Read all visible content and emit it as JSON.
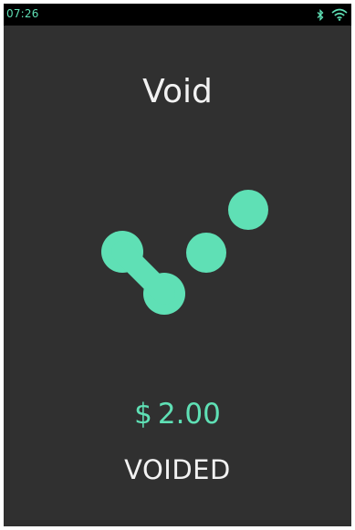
{
  "status_bar": {
    "time": "07:26",
    "icons": [
      "bluetooth-icon",
      "wifi-icon"
    ]
  },
  "screen": {
    "title": "Void",
    "amount": {
      "currency": "$",
      "value": "2.00"
    },
    "status": "VOIDED"
  },
  "colors": {
    "accent": "#5fe0b5",
    "background": "#303030",
    "status_bar": "#000000",
    "text": "#f2f2f2"
  }
}
